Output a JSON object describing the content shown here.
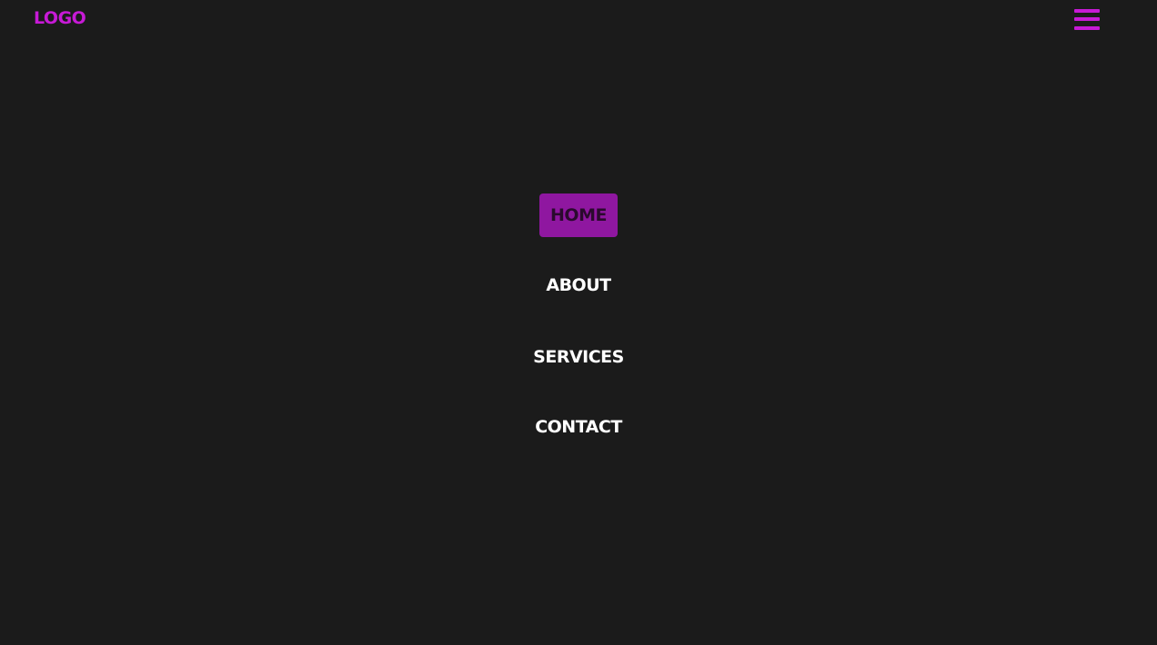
{
  "header": {
    "logo_text": "LOGO",
    "menu_icon": "hamburger-menu-icon"
  },
  "nav": {
    "items": [
      {
        "label": "HOME",
        "active": true
      },
      {
        "label": "ABOUT",
        "active": false
      },
      {
        "label": "SERVICES",
        "active": false
      },
      {
        "label": "CONTACT",
        "active": false
      }
    ]
  },
  "colors": {
    "background": "#1b1b1b",
    "accent": "#c71ad6",
    "active_background": "#8f17a0",
    "active_text": "#2a0a2e",
    "nav_text": "#ffffff"
  }
}
